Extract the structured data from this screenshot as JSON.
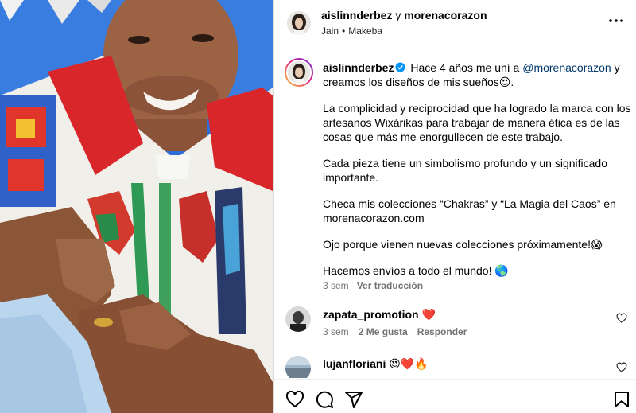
{
  "post": {
    "header": {
      "user1": "aislinnderbez",
      "joiner": "y",
      "user2": "morenacorazon",
      "location": "Jain",
      "audio": "Makeba"
    },
    "caption": {
      "username": "aislinnderbez",
      "line1_before": "Hace 4 años me uní a ",
      "mention": "@morenacorazon",
      "line1_after": " y creamos los diseños de mis sueños😍.",
      "p2": "La complicidad y reciprocidad que ha logrado la marca con los artesanos Wixárikas para trabajar de manera ética es de las cosas que más me enorgullecen de este trabajo.",
      "p3": "Cada pieza tiene un simbolismo profundo y un significado importante.",
      "p4": "Checa mis colecciones “Chakras” y “La Magia del Caos” en morenacorazon.com",
      "p5": "Ojo porque vienen nuevas colecciones próximamente!😱",
      "p6": "Hacemos envíos a todo el mundo! 🌎",
      "time": "3 sem",
      "translate": "Ver traducción"
    },
    "comments": [
      {
        "username": "zapata_promotion",
        "text": "❤️",
        "time": "3 sem",
        "likes": "2 Me gusta",
        "reply": "Responder"
      },
      {
        "username": "lujanfloriani",
        "text": "😍❤️🔥"
      }
    ]
  },
  "icons": {
    "more": "more-horizontal-icon",
    "like": "heart-icon",
    "comment": "comment-icon",
    "share": "send-icon",
    "save": "bookmark-icon",
    "verified": "verified-badge-icon"
  },
  "colors": {
    "verified": "#0095f6",
    "mention": "#00376b",
    "secondary": "#737373"
  }
}
